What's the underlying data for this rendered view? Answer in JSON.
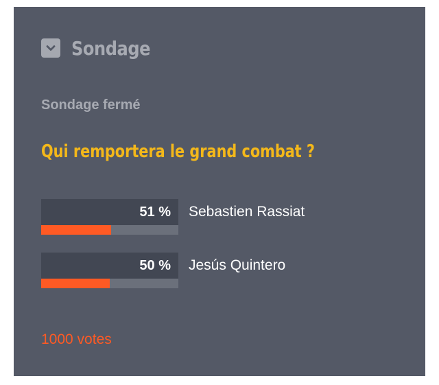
{
  "header": {
    "title": "Sondage",
    "toggle_icon": "chevron-down-icon"
  },
  "poll": {
    "status": "Sondage fermé",
    "question": "Qui remportera le grand combat ?",
    "options": [
      {
        "percent_text": "51 %",
        "percent": 51,
        "label": "Sebastien Rassiat"
      },
      {
        "percent_text": "50 %",
        "percent": 50,
        "label": "Jesús Quintero"
      }
    ],
    "votes": "1000 votes"
  },
  "colors": {
    "background": "#545966",
    "accent": "#f4b81a",
    "bar": "#ff5a24",
    "muted_text": "#a7aab2"
  }
}
